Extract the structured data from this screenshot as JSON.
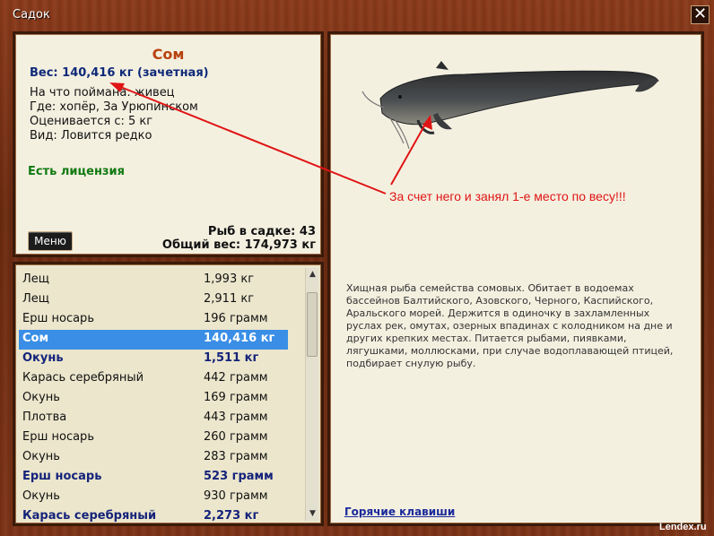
{
  "window": {
    "title": "Садок",
    "close_glyph": "✕"
  },
  "info": {
    "fish_name": "Сом",
    "weight_line": "Вес: 140,416 кг (зачетная)",
    "details": [
      "На что поймана: живец",
      "Где: хопёр, За Урюпинском",
      "Оценивается с: 5 кг",
      "Вид: Ловится редко"
    ],
    "license": "Есть лицензия",
    "menu_label": "Меню",
    "fish_count": "Рыб в садке: 43",
    "total_weight": "Общий вес: 174,973 кг"
  },
  "catch_list": [
    {
      "name": "Лещ",
      "weight": "1,993 кг",
      "style": "normal"
    },
    {
      "name": "Лещ",
      "weight": "2,911 кг",
      "style": "normal"
    },
    {
      "name": "Ерш носарь",
      "weight": "196 грамм",
      "style": "normal"
    },
    {
      "name": "Сом",
      "weight": "140,416 кг",
      "style": "selected"
    },
    {
      "name": "Окунь",
      "weight": "1,511 кг",
      "style": "bold"
    },
    {
      "name": "Карась серебряный",
      "weight": "442 грамм",
      "style": "normal"
    },
    {
      "name": "Окунь",
      "weight": "169 грамм",
      "style": "normal"
    },
    {
      "name": "Плотва",
      "weight": "443 грамм",
      "style": "normal"
    },
    {
      "name": "Ерш носарь",
      "weight": "260 грамм",
      "style": "normal"
    },
    {
      "name": "Окунь",
      "weight": "283 грамм",
      "style": "normal"
    },
    {
      "name": "Ерш носарь",
      "weight": "523 грамм",
      "style": "bold"
    },
    {
      "name": "Окунь",
      "weight": "930 грамм",
      "style": "normal"
    },
    {
      "name": "Карась серебряный",
      "weight": "2,273 кг",
      "style": "bold"
    }
  ],
  "description": "Хищная рыба семейства сомовых. Обитает в водоемах бассейнов Балтийского, Азовского, Черного, Каспийского, Аральского морей. Держится в одиночку в захламленных руслах рек, омутах, озерных впадинах с колодником на дне и других крепких местах. Питается рыбами, пиявками, лягушками, моллюсками, при случае водоплавающей птицей, подбирает снулую рыбу.",
  "hotkeys_label": "Горячие клавиши",
  "annotation": "За счет него и занял 1-е место по весу!!!",
  "watermark": "Lendex.ru",
  "colors": {
    "frame_wood": "#6b2a10",
    "panel_bg": "#f4f0e0",
    "selection": "#3a8ee6",
    "fish_name": "#b8430f",
    "annotation": "#e01515"
  },
  "icons": {
    "close": "close-icon",
    "scroll_up": "scroll-up-arrow-icon",
    "scroll_down": "scroll-down-arrow-icon"
  }
}
